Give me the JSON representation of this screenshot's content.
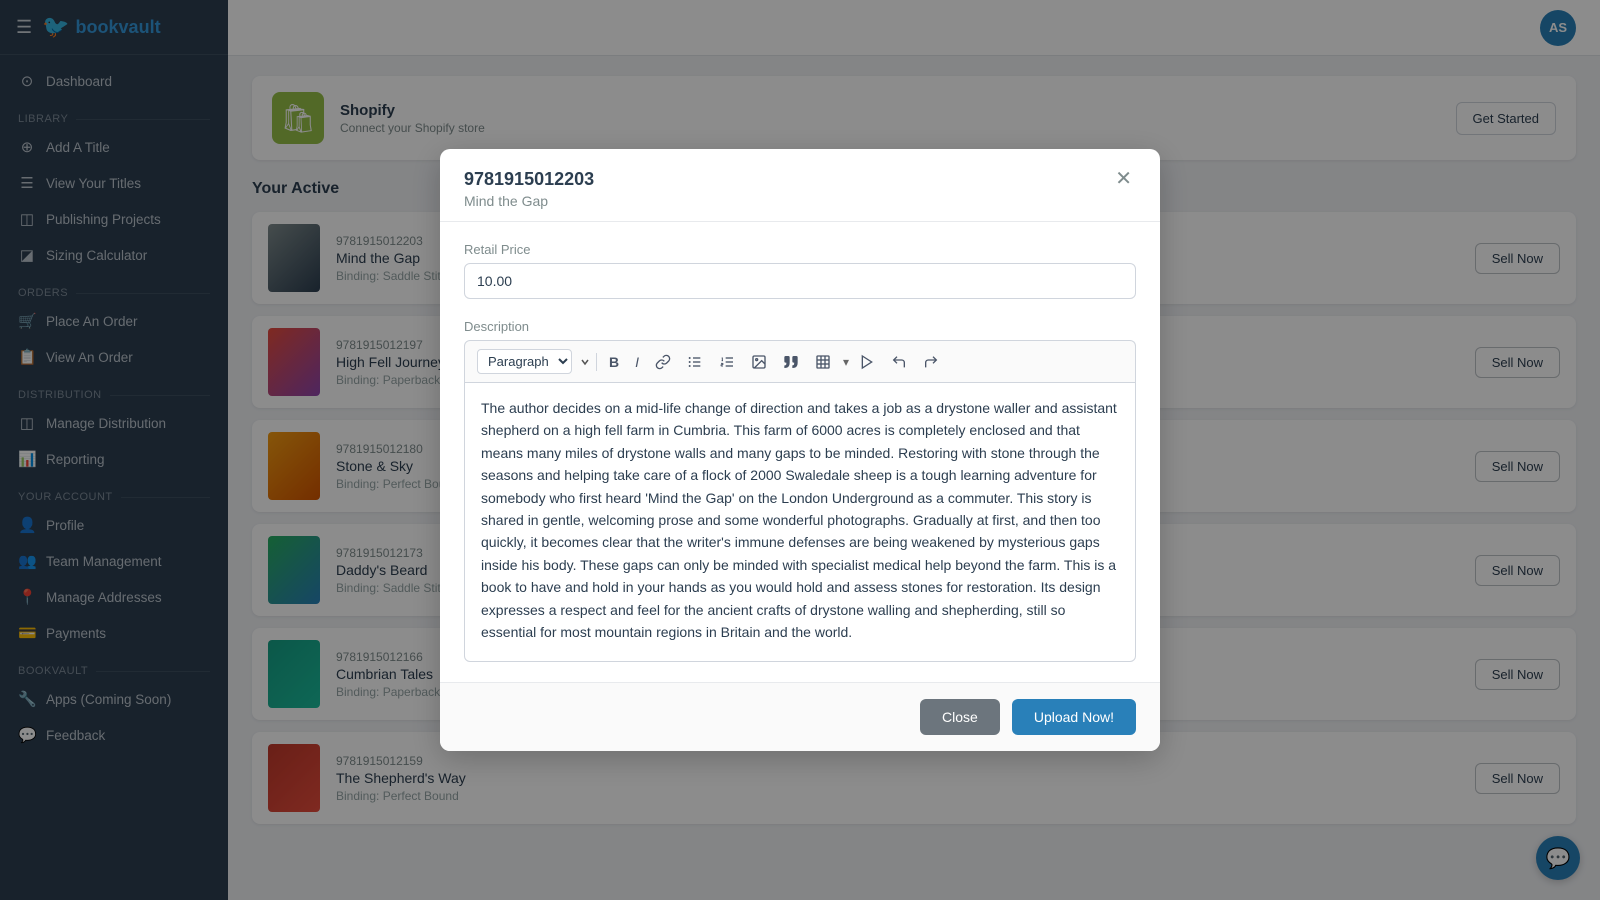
{
  "brand": {
    "name_part1": "book",
    "name_part2": "vault",
    "logo_icon": "🐦"
  },
  "sidebar": {
    "sections": [
      {
        "label": "",
        "items": [
          {
            "id": "dashboard",
            "label": "Dashboard",
            "icon": "⊙"
          }
        ]
      },
      {
        "label": "Library",
        "items": [
          {
            "id": "add-title",
            "label": "Add A Title",
            "icon": "⊕"
          },
          {
            "id": "view-titles",
            "label": "View Your Titles",
            "icon": "☰"
          },
          {
            "id": "publishing-projects",
            "label": "Publishing Projects",
            "icon": "◫"
          },
          {
            "id": "sizing-calculator",
            "label": "Sizing Calculator",
            "icon": "◪"
          }
        ]
      },
      {
        "label": "Orders",
        "items": [
          {
            "id": "place-order",
            "label": "Place An Order",
            "icon": "🛒"
          },
          {
            "id": "view-order",
            "label": "View An Order",
            "icon": "📋"
          }
        ]
      },
      {
        "label": "Distribution",
        "items": [
          {
            "id": "manage-distribution",
            "label": "Manage Distribution",
            "icon": "◫"
          },
          {
            "id": "reporting",
            "label": "Reporting",
            "icon": "📊"
          }
        ]
      },
      {
        "label": "Your Account",
        "items": [
          {
            "id": "profile",
            "label": "Profile",
            "icon": "👤"
          },
          {
            "id": "team-management",
            "label": "Team Management",
            "icon": "👥"
          },
          {
            "id": "manage-addresses",
            "label": "Manage Addresses",
            "icon": "📍"
          },
          {
            "id": "payments",
            "label": "Payments",
            "icon": "💳"
          }
        ]
      },
      {
        "label": "Bookvault",
        "items": [
          {
            "id": "apps",
            "label": "Apps (Coming Soon)",
            "icon": "🔧"
          },
          {
            "id": "feedback",
            "label": "Feedback",
            "icon": "💬"
          }
        ]
      }
    ]
  },
  "topbar": {
    "avatar_initials": "AS"
  },
  "shopify": {
    "title": "Shopify",
    "subtitle": "Connect your Shopify store",
    "cta": "Get Started"
  },
  "active_section_title": "Your Active",
  "titles": [
    {
      "isbn": "9781915012203",
      "name": "Mind the Gap",
      "binding": "Saddle Stitch",
      "binding_label": "Binding",
      "thumb_class": "thumb-1"
    },
    {
      "isbn": "9781915012197",
      "name": "High Fell Journey",
      "binding": "Paperback",
      "binding_label": "Binding",
      "thumb_class": "thumb-2"
    },
    {
      "isbn": "9781915012180",
      "name": "Stone & Sky",
      "binding": "Perfect Bound",
      "binding_label": "Binding",
      "thumb_class": "thumb-3"
    },
    {
      "isbn": "9781915012173",
      "name": "Daddy's Beard",
      "binding": "Saddle Stitch",
      "binding_label": "Binding",
      "thumb_class": "thumb-4"
    },
    {
      "isbn": "9781915012166",
      "name": "Cumbrian Tales",
      "binding": "Paperback",
      "binding_label": "Binding",
      "thumb_class": "thumb-5"
    },
    {
      "isbn": "9781915012159",
      "name": "The Shepherd's Way",
      "binding": "Perfect Bound",
      "binding_label": "Binding",
      "thumb_class": "thumb-6"
    }
  ],
  "sell_now_label": "Sell Now",
  "modal": {
    "isbn": "9781915012203",
    "title": "Mind the Gap",
    "retail_price_label": "Retail Price",
    "retail_price_value": "10.00",
    "description_label": "Description",
    "description_text": "The author decides on a mid-life change of direction and takes a job as a drystone waller and assistant shepherd on a high fell farm in Cumbria. This farm of 6000 acres is completely enclosed and that means many miles of drystone walls and many gaps to be minded. Restoring with stone through the seasons and helping take care of a flock of 2000 Swaledale sheep is a tough learning adventure for somebody who first heard 'Mind the Gap' on the London Underground as a commuter. This story is shared in gentle, welcoming prose and some wonderful photographs. Gradually at first, and then too quickly, it becomes clear that the writer's immune defenses are being weakened by mysterious gaps inside his body. These gaps can only be minded with specialist medical help beyond the farm. This is a book to have and hold in your hands as you would hold and assess stones for restoration. Its design expresses a respect and feel for the ancient crafts of drystone walling and shepherding, still so essential for most mountain regions in Britain and the world.",
    "toolbar": {
      "paragraph_select": "Paragraph",
      "bold_label": "B",
      "italic_label": "I"
    },
    "close_btn_label": "Close",
    "upload_btn_label": "Upload Now!"
  },
  "chat_icon": "💬"
}
